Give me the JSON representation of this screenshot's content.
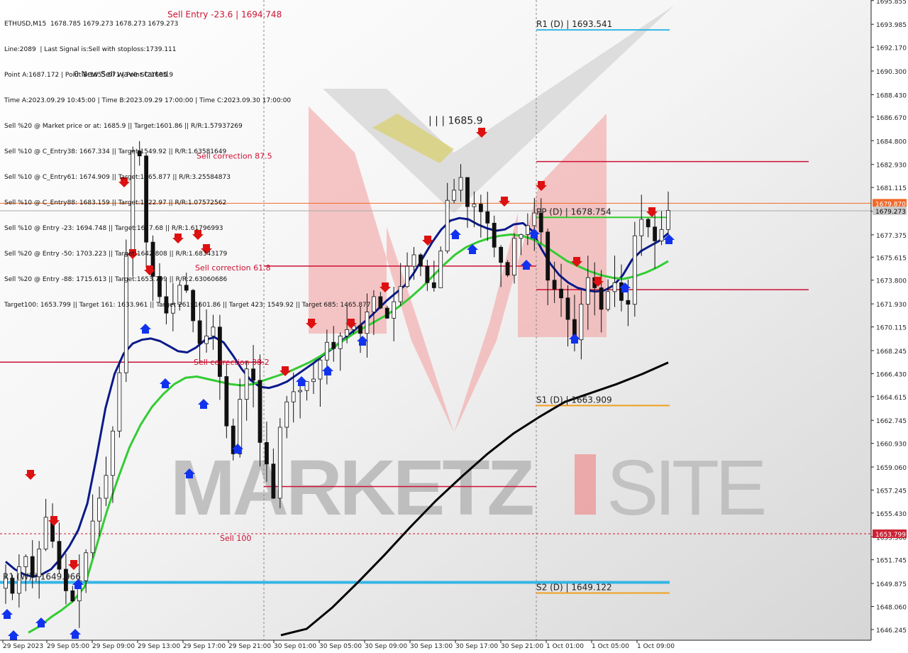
{
  "info_lines": [
    "ETHUSD,M15  1678.785 1679.273 1678.273 1679.273",
    "Line:2089  | Last Signal is:Sell with stoploss:1739.111",
    "Point A:1687.172 | Point B:1655.071 | Point C:1685.9",
    "Time A:2023.09.29 10:45:00 | Time B:2023.09.29 17:00:00 | Time C:2023.09.30 17:00:00",
    "Sell %20 @ Market price or at: 1685.9 || Target:1601.86 || R/R:1.57937269",
    "Sell %10 @ C_Entry38: 1667.334 || Target:1549.92 || R/R:1.63581649",
    "Sell %10 @ C_Entry61: 1674.909 || Target:1465.877 || R/R:3.25584873",
    "Sell %10 @ C_Entry88: 1683.159 || Target:1622.97 || R/R:1.07572562",
    "Sell %10 @ Entry -23: 1694.748 || Target:1627.68 || R/R:1.61796993",
    "Sell %20 @ Entry -50: 1703.223 || Target:1642.808 || R/R:1.68343179",
    "Sell %20 @ Entry -88: 1715.613 || Target:1653.799 || R/R:2.63060686",
    "Target100: 1653.799 || Target 161: 1633.961 || Target 261: 1601.86 || Target 423: 1549.92 || Target 685: 1465.877"
  ],
  "wave_note": "0 New Sell wave started",
  "watermark": {
    "brand_part1": "MARKETZ",
    "brand_part2": "SITE"
  },
  "colors": {
    "bull_candle": "#111111",
    "bear_candle": "#111111",
    "ma_fast": "#0a1a8a",
    "ma_mid": "#33cc33",
    "ma_slow": "#000000",
    "pivot_r1": "#35b6e6",
    "pivot_pp": "#33cc33",
    "pivot_s": "#f0a020",
    "correction": "#cc1133",
    "sell_arrow": "#dd1111",
    "buy_arrow": "#1133ee",
    "current_price_bg": "#f06a2a",
    "target_price_bg": "#cc2233"
  },
  "chart_data": {
    "type": "candlestick",
    "symbol": "ETHUSD",
    "timeframe": "M15",
    "ylim": [
      1645.4,
      1695.9
    ],
    "y_ticks": [
      1695.855,
      1693.985,
      1692.17,
      1690.3,
      1688.43,
      1686.67,
      1684.8,
      1682.93,
      1681.115,
      1679.245,
      1677.375,
      1675.615,
      1673.8,
      1671.93,
      1670.115,
      1668.245,
      1666.43,
      1664.615,
      1662.745,
      1660.93,
      1659.06,
      1657.245,
      1655.43,
      1653.56,
      1651.745,
      1649.875,
      1648.06,
      1646.245
    ],
    "y_tick_labels": [
      "1695.855",
      "1693.985",
      "1692.170",
      "1690.300",
      "1688.430",
      "1686.670",
      "1684.800",
      "1682.930",
      "1681.115",
      "1679.245",
      "1677.375",
      "1675.615",
      "1673.800",
      "1671.930",
      "1670.115",
      "1668.245",
      "1666.430",
      "1664.615",
      "1662.745",
      "1660.930",
      "1659.060",
      "1657.245",
      "1655.430",
      "1653.560",
      "1651.745",
      "1649.875",
      "1648.060",
      "1646.245"
    ],
    "x_labels": [
      "29 Sep 2023",
      "29 Sep 05:00",
      "29 Sep 09:00",
      "29 Sep 13:00",
      "29 Sep 17:00",
      "29 Sep 21:00",
      "30 Sep 01:00",
      "30 Sep 05:00",
      "30 Sep 09:00",
      "30 Sep 13:00",
      "30 Sep 17:00",
      "30 Sep 21:00",
      "1 Oct 01:00",
      "1 Oct 05:00",
      "1 Oct 09:00"
    ],
    "current_price": {
      "value": 1679.273,
      "label": "1679.273"
    },
    "pivot_price": {
      "value": 1679.87,
      "label": "1679.870"
    },
    "target_price": {
      "value": 1653.799,
      "label": "1653.799"
    },
    "levels": [
      {
        "name": "R1 (D) | 1693.541",
        "value": 1693.541,
        "kind": "pivot_r1"
      },
      {
        "name": "PP (D) | 1678.754",
        "value": 1678.754,
        "kind": "pivot_pp"
      },
      {
        "name": "S1 (D) | 1663.909",
        "value": 1663.909,
        "kind": "pivot_s"
      },
      {
        "name": "S2 (D) | 1649.122",
        "value": 1649.122,
        "kind": "pivot_s"
      },
      {
        "name": "R1 (W) | 1649.966",
        "value": 1649.966,
        "kind": "pivot_r1_week"
      }
    ],
    "corrections": [
      {
        "label": "Sell Entry -23.6 | 1694.748",
        "value": 1694.748
      },
      {
        "label": "Sell correction 87.5",
        "value": 1683.159
      },
      {
        "label": "Sell correction 61.8",
        "value": 1674.909
      },
      {
        "label": "Sell correction 38.2",
        "value": 1667.334
      },
      {
        "label": "Sell 100",
        "value": 1657.523
      }
    ],
    "point_c_label": "| | | 1685.9",
    "series": [
      {
        "name": "close",
        "values": [
          1650.3,
          1649.1,
          1651.2,
          1652.0,
          1650.4,
          1652.6,
          1655.1,
          1653.2,
          1651.0,
          1649.3,
          1648.5,
          1650.1,
          1652.3,
          1654.8,
          1656.6,
          1658.4,
          1661.9,
          1666.5,
          1675.8,
          1684.0,
          1683.6,
          1676.8,
          1674.1,
          1672.5,
          1671.2,
          1671.9,
          1673.4,
          1673.0,
          1670.6,
          1668.8,
          1669.4,
          1670.1,
          1666.2,
          1662.3,
          1660.1,
          1664.4,
          1666.8,
          1665.9,
          1661.0,
          1659.3,
          1656.6,
          1662.2,
          1664.2,
          1665.0,
          1665.1,
          1665.8,
          1666.0,
          1667.5,
          1668.9,
          1668.4,
          1669.4,
          1669.9,
          1670.2,
          1669.6,
          1671.3,
          1672.5,
          1671.6,
          1670.8,
          1672.1,
          1673.3,
          1674.9,
          1675.8,
          1674.9,
          1673.6,
          1673.2,
          1676.1,
          1680.1,
          1680.9,
          1681.9,
          1679.6,
          1679.8,
          1679.2,
          1678.3,
          1676.4,
          1675.2,
          1674.2,
          1677.1,
          1677.4,
          1678.1,
          1679.1,
          1677.6,
          1673.8,
          1673.1,
          1672.4,
          1670.7,
          1669.1,
          1671.9,
          1674.0,
          1673.2,
          1671.5,
          1672.9,
          1673.6,
          1672.2,
          1671.9,
          1677.3,
          1678.6,
          1678.0,
          1676.9,
          1677.8,
          1679.3
        ]
      },
      {
        "name": "ma_fast",
        "values": [
          1651.6,
          1651.0,
          1650.6,
          1650.4,
          1650.6,
          1651.0,
          1651.8,
          1652.8,
          1654.1,
          1656.2,
          1659.8,
          1663.7,
          1666.4,
          1668.0,
          1668.8,
          1669.1,
          1669.2,
          1669.0,
          1668.6,
          1668.2,
          1668.1,
          1668.5,
          1669.1,
          1669.3,
          1668.9,
          1667.9,
          1666.8,
          1665.9,
          1665.4,
          1665.3,
          1665.5,
          1665.8,
          1666.3,
          1666.8,
          1667.3,
          1667.9,
          1668.4,
          1669.0,
          1669.6,
          1670.2,
          1670.8,
          1671.5,
          1672.2,
          1672.8,
          1673.4,
          1674.4,
          1675.6,
          1676.8,
          1677.8,
          1678.5,
          1678.7,
          1678.6,
          1678.2,
          1677.9,
          1677.7,
          1677.8,
          1678.2,
          1678.3,
          1677.7,
          1676.3,
          1675.1,
          1674.2,
          1673.6,
          1673.2,
          1673.0,
          1672.9,
          1673.0,
          1673.4,
          1674.2,
          1675.4,
          1676.1,
          1676.5,
          1676.9,
          1677.5
        ]
      },
      {
        "name": "ma_mid",
        "values": [
          1646.0,
          1646.5,
          1647.2,
          1647.8,
          1648.5,
          1649.6,
          1652.6,
          1655.6,
          1658.2,
          1660.6,
          1662.4,
          1663.8,
          1664.8,
          1665.6,
          1666.1,
          1666.2,
          1666.0,
          1665.8,
          1665.6,
          1665.5,
          1665.6,
          1665.9,
          1666.2,
          1666.5,
          1666.9,
          1667.3,
          1667.8,
          1668.4,
          1669.0,
          1669.6,
          1670.1,
          1670.6,
          1671.1,
          1671.7,
          1672.4,
          1673.2,
          1674.1,
          1675.0,
          1675.8,
          1676.4,
          1676.8,
          1677.1,
          1677.3,
          1677.4,
          1677.3,
          1677.0,
          1676.5,
          1675.9,
          1675.3,
          1674.9,
          1674.5,
          1674.2,
          1674.0,
          1673.9,
          1674.1,
          1674.4,
          1674.8,
          1675.3
        ]
      },
      {
        "name": "ma_slow",
        "values": [
          1645.8,
          1646.3,
          1648.0,
          1650.0,
          1652.1,
          1654.3,
          1656.4,
          1658.3,
          1660.1,
          1661.7,
          1663.0,
          1664.2,
          1664.9,
          1665.6,
          1666.4,
          1667.3
        ]
      }
    ]
  }
}
